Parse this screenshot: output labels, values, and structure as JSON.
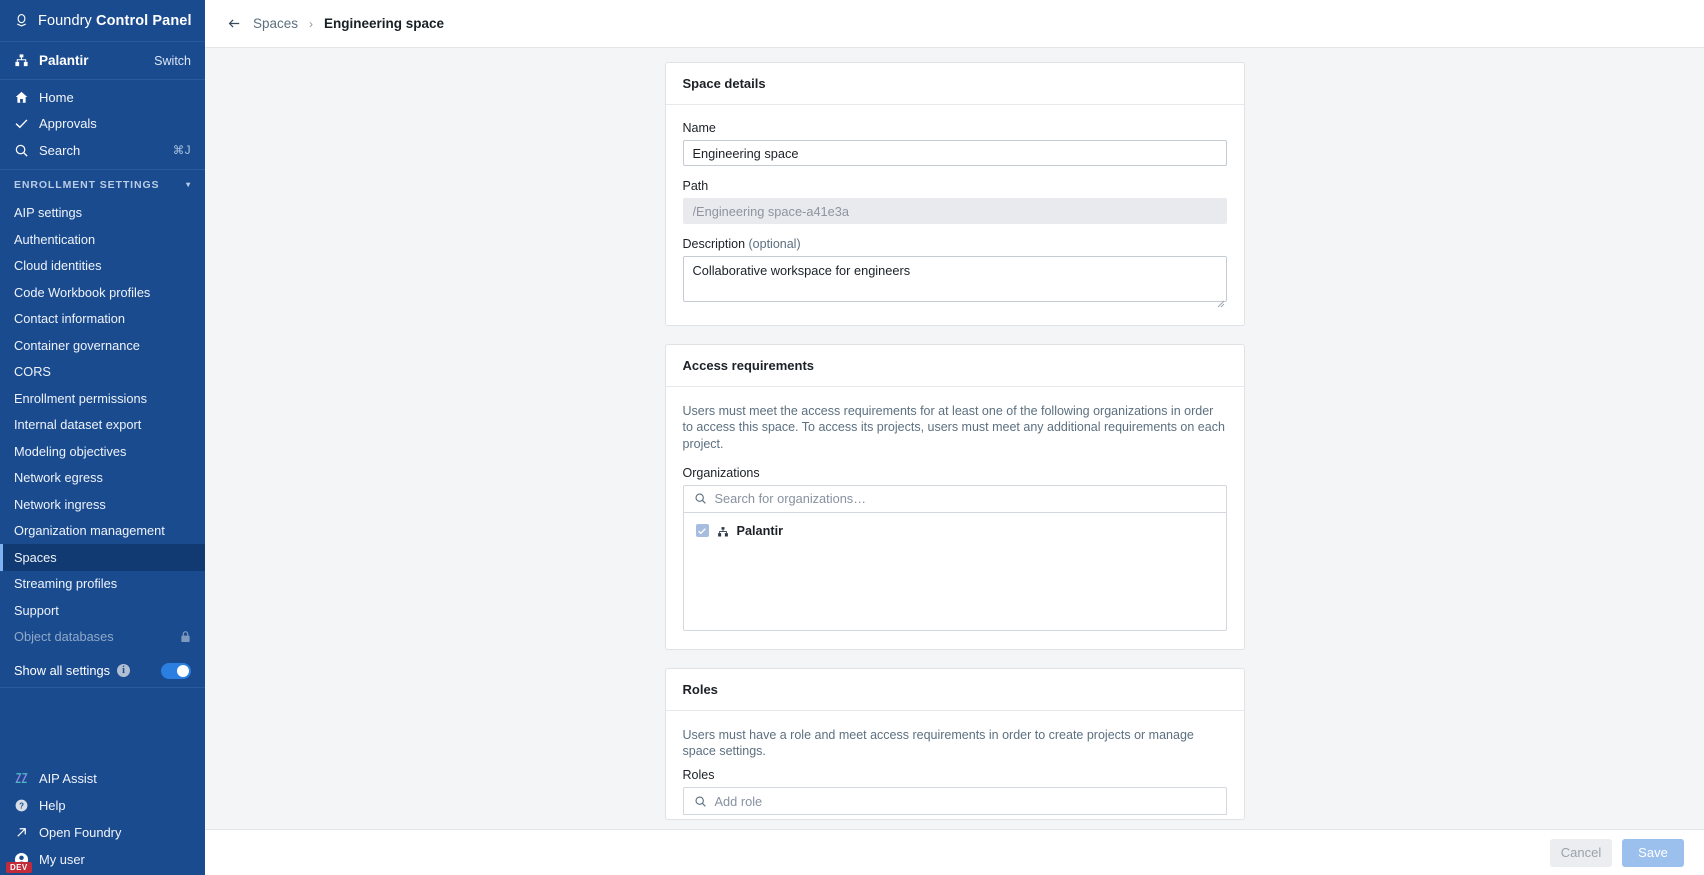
{
  "sidebar": {
    "brand": {
      "prefix": "Foundry ",
      "bold": "Control Panel",
      "icon": "foundry-logo-icon"
    },
    "org": {
      "name": "Palantir",
      "switch_label": "Switch",
      "icon": "org-hierarchy-icon"
    },
    "nav": [
      {
        "label": "Home",
        "icon": "home-icon",
        "shortcut": ""
      },
      {
        "label": "Approvals",
        "icon": "check-icon",
        "shortcut": ""
      },
      {
        "label": "Search",
        "icon": "search-icon",
        "shortcut": "⌘J"
      }
    ],
    "section": {
      "label": "ENROLLMENT SETTINGS",
      "caret": "▾"
    },
    "links": [
      {
        "label": "AIP settings",
        "active": false,
        "disabled": false
      },
      {
        "label": "Authentication",
        "active": false,
        "disabled": false
      },
      {
        "label": "Cloud identities",
        "active": false,
        "disabled": false
      },
      {
        "label": "Code Workbook profiles",
        "active": false,
        "disabled": false
      },
      {
        "label": "Contact information",
        "active": false,
        "disabled": false
      },
      {
        "label": "Container governance",
        "active": false,
        "disabled": false
      },
      {
        "label": "CORS",
        "active": false,
        "disabled": false
      },
      {
        "label": "Enrollment permissions",
        "active": false,
        "disabled": false
      },
      {
        "label": "Internal dataset export",
        "active": false,
        "disabled": false
      },
      {
        "label": "Modeling objectives",
        "active": false,
        "disabled": false
      },
      {
        "label": "Network egress",
        "active": false,
        "disabled": false
      },
      {
        "label": "Network ingress",
        "active": false,
        "disabled": false
      },
      {
        "label": "Organization management",
        "active": false,
        "disabled": false
      },
      {
        "label": "Spaces",
        "active": true,
        "disabled": false
      },
      {
        "label": "Streaming profiles",
        "active": false,
        "disabled": false
      },
      {
        "label": "Support",
        "active": false,
        "disabled": false
      },
      {
        "label": "Object databases",
        "active": false,
        "disabled": true,
        "icon": "lock-icon"
      }
    ],
    "show_all_settings": {
      "label": "Show all settings",
      "info_icon": "info-icon",
      "toggle_on": true
    },
    "bottom": [
      {
        "label": "AIP Assist",
        "icon": "aip-assist-icon"
      },
      {
        "label": "Help",
        "icon": "help-circle-icon"
      },
      {
        "label": "Open Foundry",
        "icon": "external-link-icon"
      },
      {
        "label": "My user",
        "icon": "user-avatar-icon"
      }
    ],
    "dev_badge": "DEV"
  },
  "topbar": {
    "back_icon": "back-arrow-icon",
    "breadcrumb_parent": "Spaces",
    "breadcrumb_sep": "›",
    "breadcrumb_current": "Engineering space"
  },
  "space_details": {
    "title": "Space details",
    "name_label": "Name",
    "name_value": "Engineering space",
    "path_label": "Path",
    "path_value": "/Engineering space-a41e3a",
    "description_label": "Description ",
    "description_optional": "(optional)",
    "description_value": "Collaborative workspace for engineers"
  },
  "access_requirements": {
    "title": "Access requirements",
    "help": "Users must meet the access requirements for at least one of the following organizations in order to access this space. To access its projects, users must meet any additional requirements on each project.",
    "orgs_label": "Organizations",
    "search_placeholder": "Search for organizations…",
    "search_icon": "search-icon",
    "items": [
      {
        "label": "Palantir",
        "checked": true,
        "icon": "org-hierarchy-icon"
      }
    ]
  },
  "roles": {
    "title": "Roles",
    "help": "Users must have a role and meet access requirements in order to create projects or manage space settings.",
    "roles_label": "Roles",
    "search_placeholder": "Add role"
  },
  "footer": {
    "cancel_label": "Cancel",
    "save_label": "Save"
  },
  "colors": {
    "sidebar_bg": "#1b4b8f",
    "sidebar_active": "#123a72",
    "accent": "#7fb2f0",
    "content_bg": "#f4f5f7",
    "toggle_on": "#2a7fe0",
    "checkbox": "#a7bde0",
    "save_disabled": "#9cc0ee",
    "dev_badge": "#c42b3a"
  }
}
